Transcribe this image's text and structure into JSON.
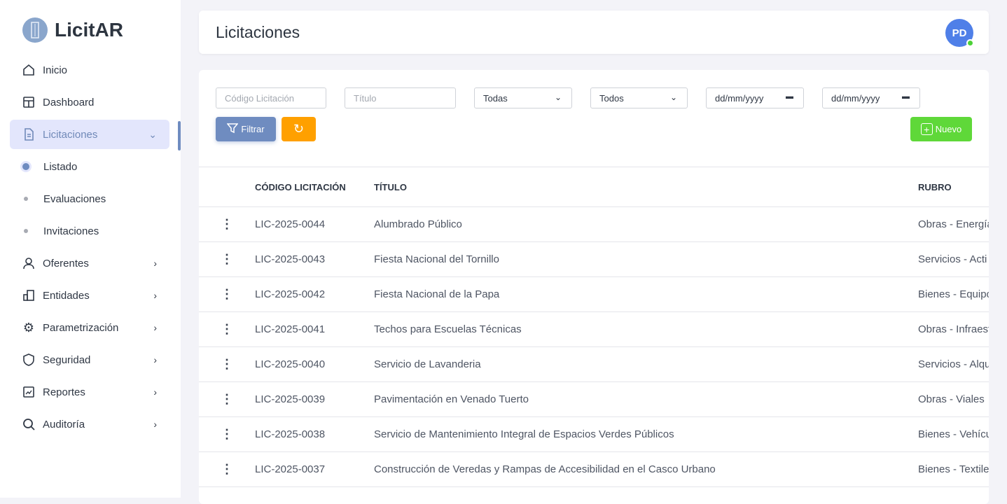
{
  "app": {
    "name": "LicitAR"
  },
  "sidebar": {
    "items": [
      {
        "label": "Inicio"
      },
      {
        "label": "Dashboard"
      },
      {
        "label": "Licitaciones"
      }
    ],
    "sub": [
      {
        "label": "Listado"
      },
      {
        "label": "Evaluaciones"
      },
      {
        "label": "Invitaciones"
      }
    ],
    "more": [
      {
        "label": "Oferentes"
      },
      {
        "label": "Entidades"
      },
      {
        "label": "Parametrización"
      },
      {
        "label": "Seguridad"
      },
      {
        "label": "Reportes"
      },
      {
        "label": "Auditoría"
      }
    ]
  },
  "header": {
    "title": "Licitaciones",
    "avatar": "PD"
  },
  "filters": {
    "codigo_placeholder": "Código Licitación",
    "titulo_placeholder": "Título",
    "select1": "Todas",
    "select2": "Todos",
    "date1": "dd/mm/yyyy",
    "date2": "dd/mm/yyyy",
    "filtrar": "Filtrar",
    "nuevo": "Nuevo"
  },
  "colors": {
    "primary": "#6f8cc0",
    "reset": "#ffa000",
    "nuevo": "#5fd839"
  },
  "table": {
    "headers": [
      "CÓDIGO LICITACIÓN",
      "TÍTULO",
      "RUBRO"
    ],
    "rows": [
      [
        "LIC-2025-0044",
        "Alumbrado Público",
        "Obras - Energía"
      ],
      [
        "LIC-2025-0043",
        "Fiesta Nacional del Tornillo",
        "Servicios - Acti"
      ],
      [
        "LIC-2025-0042",
        "Fiesta Nacional de la Papa",
        "Bienes - Equipo"
      ],
      [
        "LIC-2025-0041",
        "Techos para Escuelas Técnicas",
        "Obras - Infraest"
      ],
      [
        "LIC-2025-0040",
        "Servicio de Lavanderia",
        "Servicios - Alqu"
      ],
      [
        "LIC-2025-0039",
        "Pavimentación en Venado Tuerto",
        "Obras - Viales"
      ],
      [
        "LIC-2025-0038",
        "Servicio de Mantenimiento Integral de Espacios Verdes Públicos",
        "Bienes - Vehícu"
      ],
      [
        "LIC-2025-0037",
        "Construcción de Veredas y Rampas de Accesibilidad en el Casco Urbano",
        "Bienes - Textile"
      ]
    ]
  }
}
